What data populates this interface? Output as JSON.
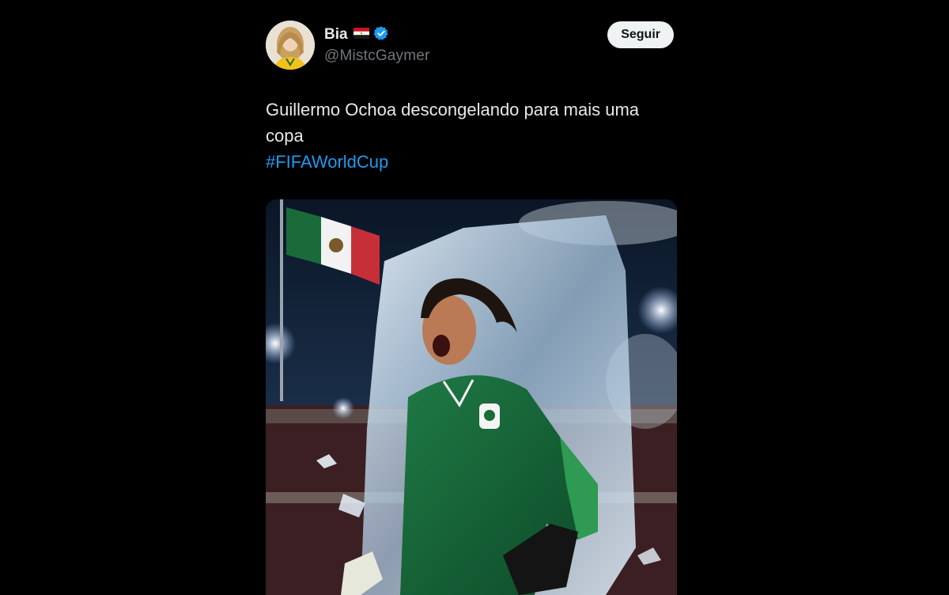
{
  "tweet": {
    "author": {
      "display_name": "Bia",
      "handle": "@MistcGaymer",
      "flag_icon": "flag-egypt-icon",
      "verified_icon": "verified-badge-icon",
      "verified_color": "#1d9bf0"
    },
    "follow_label": "Seguir",
    "text_line": "Guillermo Ochoa descongelando para mais uma copa",
    "hashtag": "#FIFAWorldCup",
    "hashtag_color": "#1d9bf0",
    "media": {
      "icon": "photo-icon"
    }
  }
}
